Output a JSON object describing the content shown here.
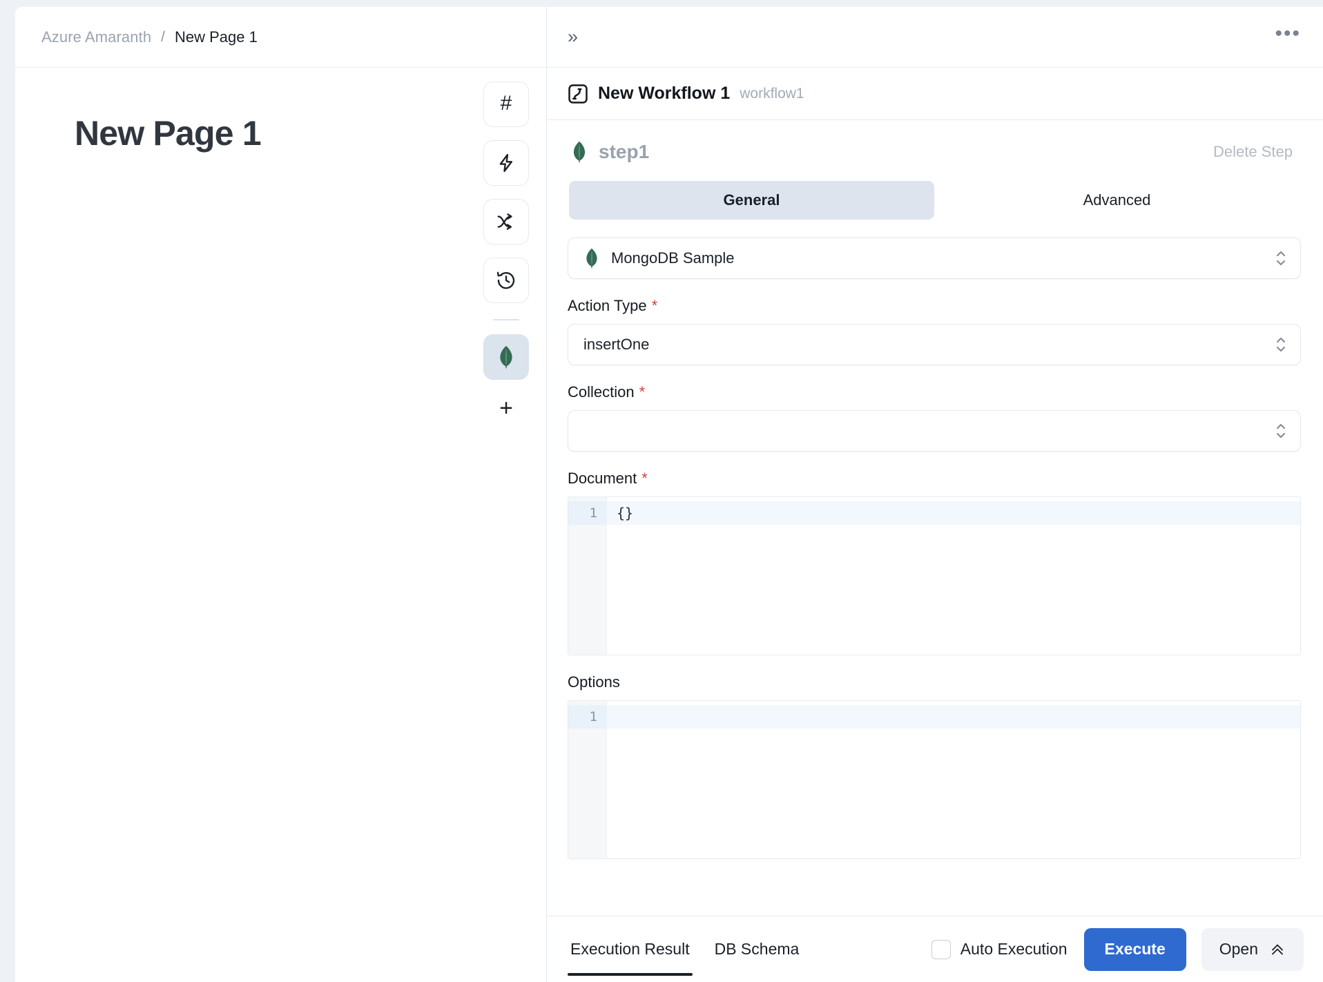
{
  "breadcrumb": {
    "root": "Azure Amaranth",
    "separator": "/",
    "current": "New Page 1"
  },
  "left_pane": {
    "page_title": "New Page 1",
    "rail": {
      "items": [
        {
          "icon": "hash-icon",
          "label": "#",
          "active": false
        },
        {
          "icon": "lightning-icon",
          "label": "",
          "active": false
        },
        {
          "icon": "branch-icon",
          "label": "",
          "active": false
        },
        {
          "icon": "history-icon",
          "label": "",
          "active": false
        },
        {
          "icon": "mongodb-leaf-icon",
          "label": "",
          "active": true
        }
      ],
      "add_label": "+"
    }
  },
  "right_pane": {
    "topbar": {
      "expand_icon": "»",
      "more_icon": "•••"
    },
    "workflow": {
      "icon": "workflow-icon",
      "name": "New Workflow 1",
      "slug": "workflow1"
    },
    "step": {
      "icon": "mongodb-leaf-icon",
      "name": "step1",
      "delete_label": "Delete Step"
    },
    "tabs": [
      {
        "label": "General",
        "active": true
      },
      {
        "label": "Advanced",
        "active": false
      }
    ],
    "resource_select": {
      "icon": "mongodb-leaf-icon",
      "value": "MongoDB Sample"
    },
    "fields": {
      "action_type": {
        "label": "Action Type",
        "required": true,
        "required_mark": "*",
        "value": "insertOne"
      },
      "collection": {
        "label": "Collection",
        "required": true,
        "required_mark": "*",
        "value": ""
      },
      "document": {
        "label": "Document",
        "required": true,
        "required_mark": "*",
        "line_number": "1",
        "code": "{}"
      },
      "options": {
        "label": "Options",
        "required": false,
        "required_mark": "",
        "line_number": "1",
        "code": ""
      }
    }
  },
  "bottom_bar": {
    "tabs": [
      {
        "label": "Execution Result",
        "active": true
      },
      {
        "label": "DB Schema",
        "active": false
      }
    ],
    "auto_execution_label": "Auto Execution",
    "auto_execution_checked": false,
    "execute_label": "Execute",
    "open_label": "Open"
  },
  "colors": {
    "accent_blue": "#2f6ad0",
    "mongodb_green": "#336b53",
    "required_red": "#d0443c",
    "tab_active_bg": "#dde4ed",
    "page_bg": "#eef1f5"
  }
}
